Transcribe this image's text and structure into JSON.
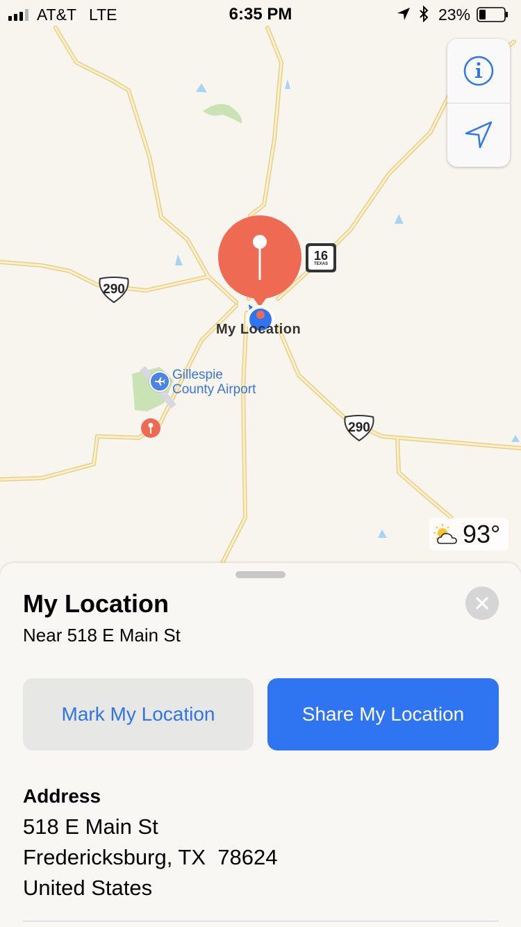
{
  "status_bar": {
    "carrier": "AT&T",
    "network": "LTE",
    "time": "6:35 PM",
    "battery_percent": "23%"
  },
  "map": {
    "controls": [
      "info-icon",
      "location-arrow-icon"
    ],
    "shields": {
      "us290_top": "290",
      "us290_bottom": "290",
      "tx16_number": "16",
      "tx16_state": "TEXAS"
    },
    "airport_label_line1": "Gillespie",
    "airport_label_line2": "County Airport",
    "my_location_label": "My Location",
    "weather_temp": "93°",
    "colors": {
      "pin_red": "#ee6a52",
      "user_dot_blue": "#2f74f0",
      "road_yellow": "#f2dfa4",
      "water": "#a9d3f2",
      "park_green": "#c9e3b5"
    }
  },
  "sheet": {
    "title": "My Location",
    "subtitle": "Near 518 E Main St",
    "mark_button": "Mark My Location",
    "share_button": "Share My Location",
    "address_heading": "Address",
    "address_line1": "518 E Main St",
    "address_line2": "Fredericksburg, TX  78624",
    "address_line3": "United States"
  }
}
